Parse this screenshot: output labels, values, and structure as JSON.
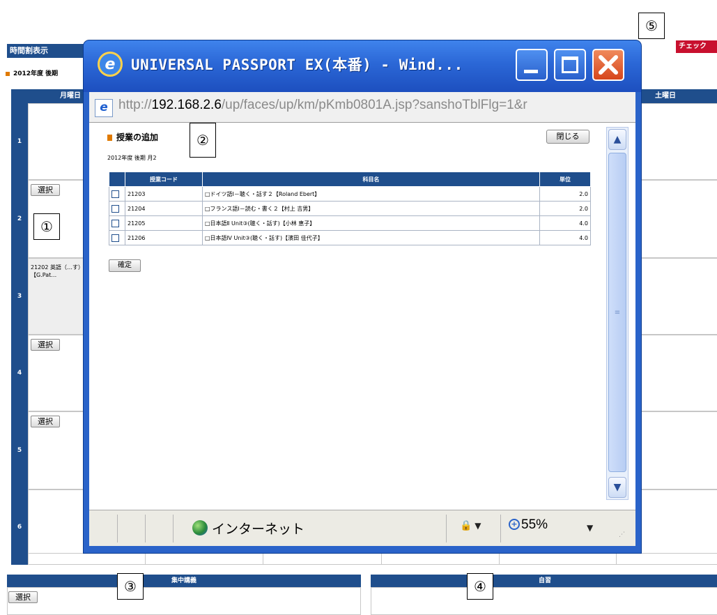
{
  "page": {
    "title": "時間割表示",
    "year_term": "2012年度 後期",
    "check_button": "チェック",
    "columns": [
      "月曜日",
      "土曜日"
    ],
    "periods": [
      "1",
      "2",
      "3",
      "4",
      "5",
      "6"
    ],
    "select_button": "選択",
    "period3_course": "21202 英語（…す）【G.Pat…",
    "bottom_left_header": "集中講義",
    "bottom_right_header": "自習"
  },
  "callouts": [
    "①",
    "②",
    "③",
    "④",
    "⑤"
  ],
  "popup": {
    "window_title": "UNIVERSAL PASSPORT EX(本番) - Wind...",
    "url_prefix": "http://",
    "url_host": "192.168.2.6",
    "url_path": "/up/faces/up/km/pKmb0801A.jsp?sanshoTblFlg=1&r",
    "heading": "授業の追加",
    "subheading": "2012年度 後期 月2",
    "close_button": "閉じる",
    "table_headers": [
      "授業コード",
      "科目名",
      "単位"
    ],
    "rows": [
      {
        "code": "21203",
        "name": "□ドイツ語Ⅰ－聴く・話す２【Roland Ebert】",
        "credit": "2.0"
      },
      {
        "code": "21204",
        "name": "□フランス語Ⅰ－読む・書く２【村上 吉男】",
        "credit": "2.0"
      },
      {
        "code": "21205",
        "name": "□日本語Ⅱ Unit③(聴く・話す)【小林 恵子】",
        "credit": "4.0"
      },
      {
        "code": "21206",
        "name": "□日本語Ⅳ Unit③(聴く・話す)【濱田 佳代子】",
        "credit": "4.0"
      }
    ],
    "confirm_button": "確定",
    "status_zone": "インターネット",
    "zoom": "55%"
  }
}
